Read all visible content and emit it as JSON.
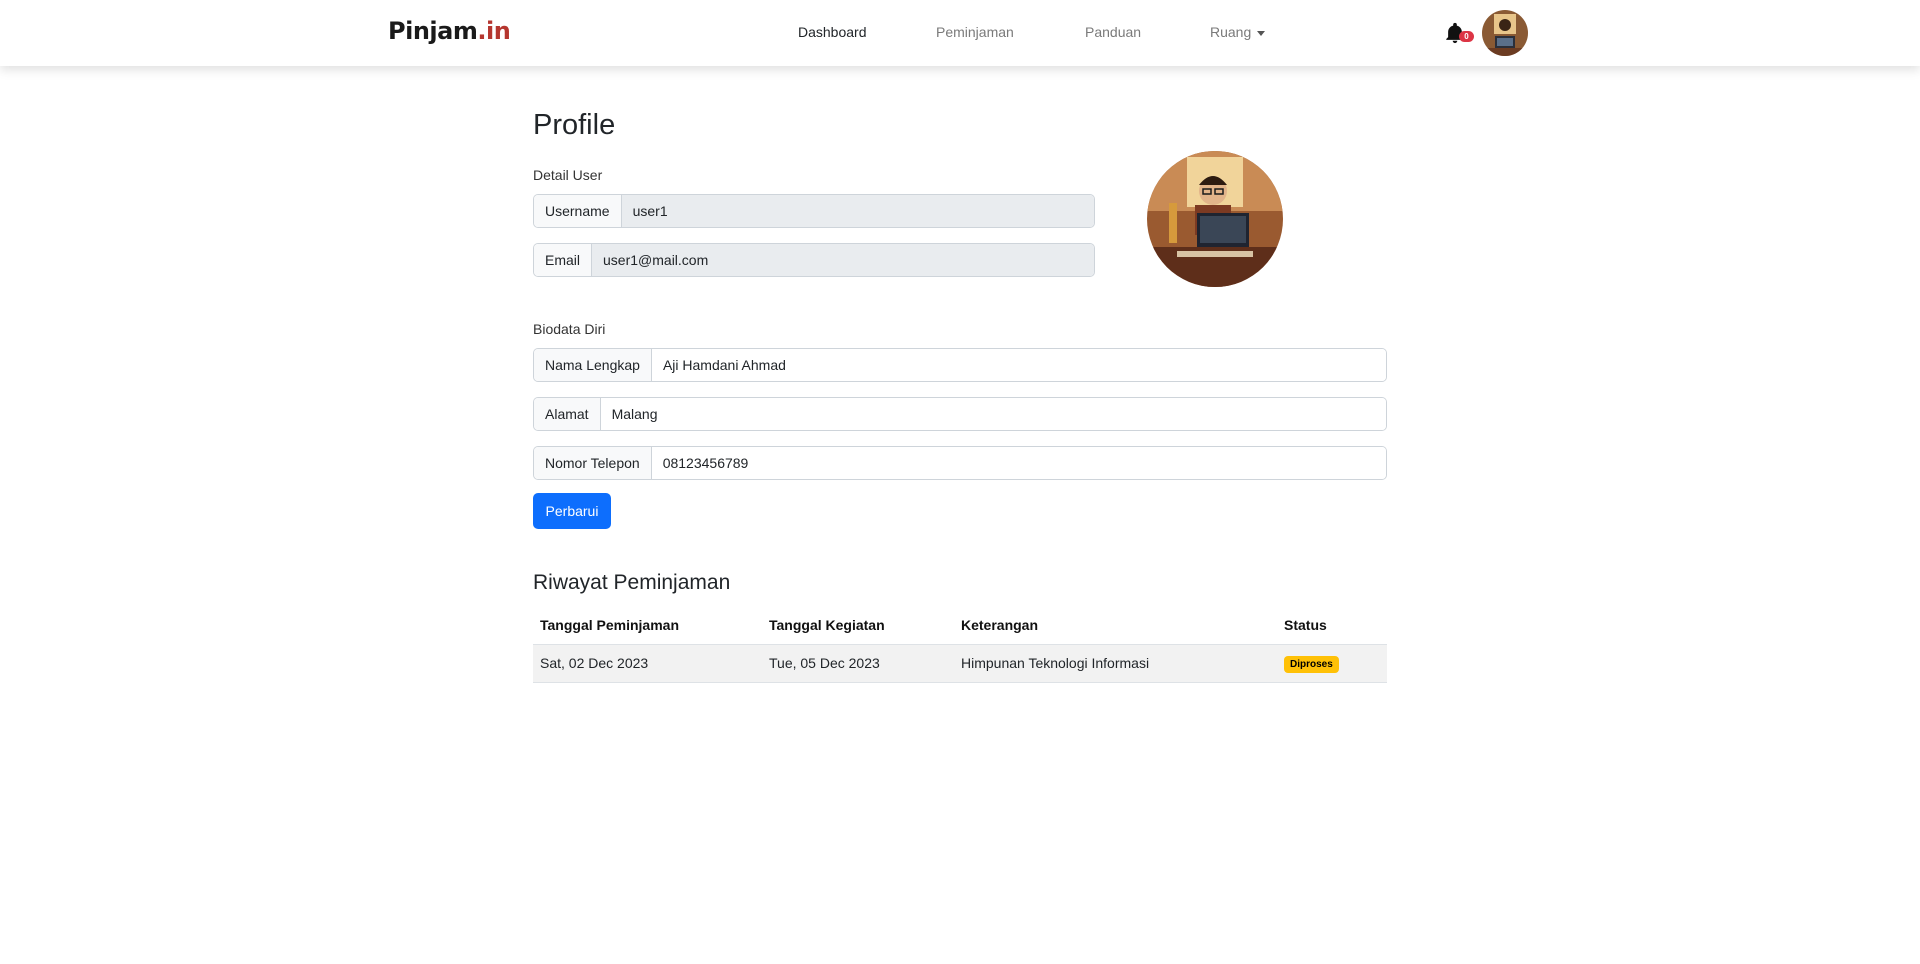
{
  "navbar": {
    "brand_main": "Pinjam",
    "brand_accent": ".in",
    "links": [
      {
        "label": "Dashboard"
      },
      {
        "label": "Peminjaman"
      },
      {
        "label": "Panduan"
      },
      {
        "label": "Ruang"
      }
    ],
    "notification_count": "0"
  },
  "profile": {
    "title": "Profile",
    "detail_label": "Detail User",
    "username_label": "Username",
    "username_value": "user1",
    "email_label": "Email",
    "email_value": "user1@mail.com",
    "bio_label": "Biodata Diri",
    "fullname_label": "Nama Lengkap",
    "fullname_value": "Aji Hamdani Ahmad",
    "address_label": "Alamat",
    "address_value": "Malang",
    "phone_label": "Nomor Telepon",
    "phone_value": "08123456789",
    "update_button": "Perbarui"
  },
  "history": {
    "title": "Riwayat Peminjaman",
    "columns": [
      "Tanggal Peminjaman",
      "Tanggal Kegiatan",
      "Keterangan",
      "Status"
    ],
    "rows": [
      {
        "borrow_date": "Sat, 02 Dec 2023",
        "event_date": "Tue, 05 Dec 2023",
        "description": "Himpunan Teknologi Informasi",
        "status": "Diproses"
      }
    ]
  },
  "colors": {
    "primary": "#0d6efd",
    "warning": "#ffc107",
    "danger": "#dc3545",
    "brand_accent": "#b5362f"
  }
}
